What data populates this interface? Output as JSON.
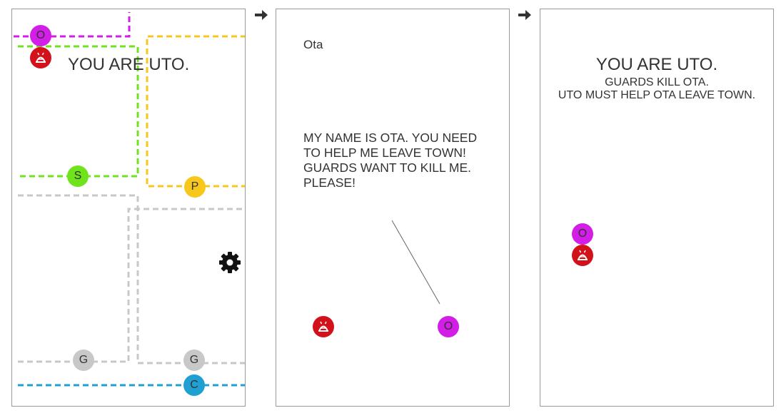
{
  "colors": {
    "purple": "#d21ee6",
    "green": "#6fe41c",
    "yellow": "#f7c81b",
    "gray": "#c8c8c8",
    "blue": "#20a0d2",
    "guard_red": "#d2111a",
    "arrow": "#333333"
  },
  "icons": {
    "arrow": "right-arrow-icon",
    "gear": "gear-icon",
    "guard": "guard-avatar-icon"
  },
  "panel1": {
    "title": "YOU ARE UTO.",
    "nodes": {
      "o": "O",
      "s": "S",
      "p": "P",
      "g1": "G",
      "g2": "G",
      "c": "C"
    }
  },
  "panel2": {
    "speaker": "Ota",
    "dialog": "MY NAME IS OTA. YOU NEED TO HELP ME LEAVE TOWN! GUARDS WANT TO KILL ME. PLEASE!",
    "node_o": "O"
  },
  "panel3": {
    "title": "YOU ARE UTO.",
    "line1": "GUARDS KILL OTA.",
    "line2": "UTO MUST HELP OTA LEAVE TOWN.",
    "node_o": "O"
  }
}
